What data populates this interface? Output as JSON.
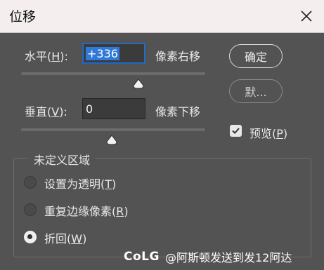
{
  "dialog": {
    "title": "位移",
    "close_glyph": "✕"
  },
  "horizontal": {
    "label": "水平(",
    "hotkey": "H",
    "label_end": "):",
    "value": "+336",
    "unit": "像素右移"
  },
  "vertical": {
    "label": "垂直(",
    "hotkey": "V",
    "label_end": "):",
    "value": "0",
    "unit": "像素下移"
  },
  "buttons": {
    "ok": "确定",
    "default": "默..."
  },
  "preview": {
    "label": "预览(",
    "hotkey": "P",
    "label_end": ")",
    "checked": true
  },
  "undefined_area": {
    "title": "未定义区域",
    "options": [
      {
        "label": "设置为透明(",
        "hotkey": "T",
        "label_end": ")",
        "selected": false
      },
      {
        "label": "重复边缘像素(",
        "hotkey": "R",
        "label_end": ")",
        "selected": false
      },
      {
        "label": "折回(",
        "hotkey": "W",
        "label_end": ")",
        "selected": true
      }
    ]
  },
  "watermark": {
    "logo": "CoLG",
    "text": "@阿斯顿发送到发12阿达"
  },
  "colors": {
    "panel": "#535353",
    "titlebar": "#f4eeee",
    "focus": "#2f7ad6"
  }
}
